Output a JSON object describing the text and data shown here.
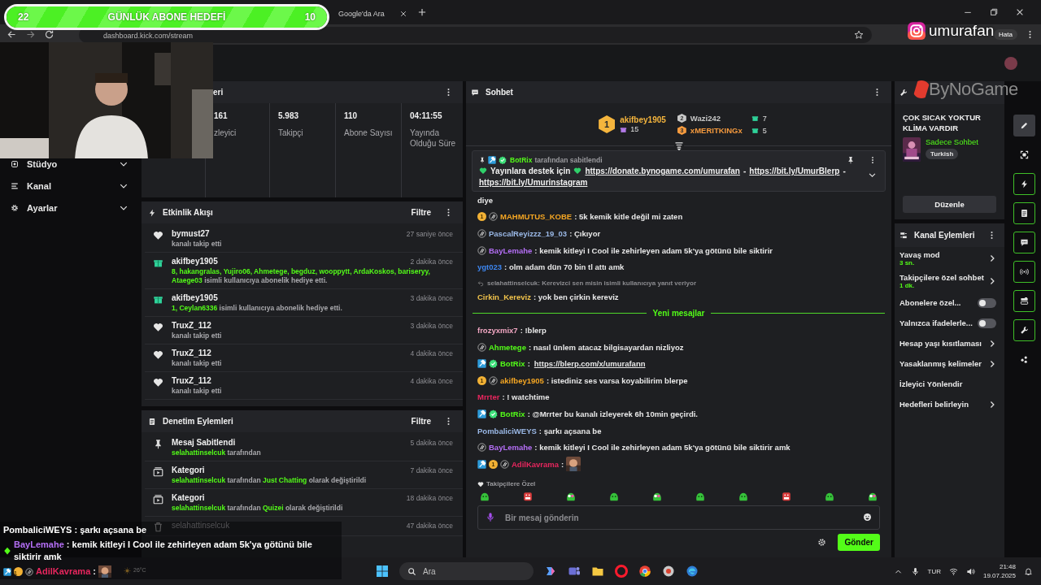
{
  "browser": {
    "tabs": [
      {
        "title": "Google'da Ara",
        "selected": false
      }
    ],
    "url": "dashboard.kick.com/stream",
    "profile": "Hata"
  },
  "sidebar": [
    {
      "kind": "studio",
      "label": "Stüdyo"
    },
    {
      "kind": "channel",
      "label": "Kanal"
    },
    {
      "kind": "settings",
      "label": "Ayarlar"
    }
  ],
  "stats": {
    "title": "eri",
    "items": [
      {
        "value": "161",
        "label": "zleyici"
      },
      {
        "value": "5.983",
        "label": "Takipçi"
      },
      {
        "value": "110",
        "label": "Abone Sayısı"
      },
      {
        "value": "04:11:55",
        "label": "Yayında Olduğu Süre"
      }
    ]
  },
  "events": {
    "title": "Etkinlik Akışı",
    "filter": "Filtre",
    "items": [
      {
        "kind": "follow",
        "user": "bymust27",
        "time": "27 saniye önce",
        "text": "kanalı takip etti"
      },
      {
        "kind": "gift",
        "user": "akifbey1905",
        "time": "2 dakika önce",
        "names": "8, hakangralas, Yujiro06, Ahmetege, begduz, wooppytt, ArdaKoskos, bariseryy, Ataege03",
        "text": "isimli kullanıcıya abonelik hediye etti."
      },
      {
        "kind": "gift",
        "user": "akifbey1905",
        "time": "3 dakika önce",
        "names": "1, Ceylan6336",
        "text": "isimli kullanıcıya abonelik hediye etti."
      },
      {
        "kind": "follow",
        "user": "TruxZ_112",
        "time": "3 dakika önce",
        "text": "kanalı takip etti"
      },
      {
        "kind": "follow",
        "user": "TruxZ_112",
        "time": "4 dakika önce",
        "text": "kanalı takip etti"
      },
      {
        "kind": "follow",
        "user": "TruxZ_112",
        "time": "4 dakika önce",
        "text": "kanalı takip etti"
      }
    ]
  },
  "moderation": {
    "title": "Denetim Eylemleri",
    "filter": "Filtre",
    "items": [
      {
        "kind": "pin",
        "title": "Mesaj Sabitlendi",
        "time": "5 dakika önce",
        "detail": [
          {
            "text": "selahattinselcuk",
            "highlight": true
          },
          {
            "text": "tarafından",
            "highlight": false
          }
        ]
      },
      {
        "kind": "category",
        "title": "Kategori",
        "time": "7 dakika önce",
        "detail": [
          {
            "text": "selahattinselcuk",
            "highlight": true
          },
          {
            "text": "tarafından",
            "highlight": false
          },
          {
            "text": "Just Chatting",
            "highlight": true
          },
          {
            "text": "olarak değiştirildi",
            "highlight": false
          }
        ]
      },
      {
        "kind": "category",
        "title": "Kategori",
        "time": "18 dakika önce",
        "detail": [
          {
            "text": "selahattinselcuk",
            "highlight": true
          },
          {
            "text": "tarafından",
            "highlight": false
          },
          {
            "text": "Quizei",
            "highlight": true
          },
          {
            "text": "olarak değiştirildi",
            "highlight": false
          }
        ]
      },
      {
        "kind": "delete",
        "title": "selahattinselcuk",
        "time": "47 dakika önce"
      }
    ]
  },
  "chat": {
    "title": "Sohbet",
    "leaderboard": [
      {
        "rank": "1",
        "user": "akifbey1905",
        "count": "15",
        "color": "#f5b53d"
      },
      {
        "rank": "2",
        "user": "Wazi242",
        "count": "7",
        "color": "#c8c8c8"
      },
      {
        "rank": "3",
        "user": "xMERITKINGx",
        "count": "5",
        "color": "#f59a3e"
      }
    ],
    "pinned": {
      "by": "BotRix",
      "note": "tarafından sabitlendi",
      "parts": [
        {
          "kind": "emoji"
        },
        {
          "kind": "text",
          "text": "Yayınlara destek için"
        },
        {
          "kind": "emoji"
        },
        {
          "kind": "link",
          "text": "https://donate.bynogame.com/umurafan"
        },
        {
          "kind": "text",
          "text": "-"
        },
        {
          "kind": "link",
          "text": "https://bit.ly/UmurBlerp"
        },
        {
          "kind": "text",
          "text": "-"
        },
        {
          "kind": "link",
          "text": "https://bit.ly/Umurinstagram"
        }
      ]
    },
    "messages": [
      {
        "kind": "continuation",
        "text": "diye"
      },
      {
        "kind": "message",
        "badges": [
          {
            "kind": "gifter",
            "text": "1"
          },
          {
            "kind": "og"
          }
        ],
        "user": "MAHMUTUS_KOBE",
        "color": "#f5a623",
        "text": ": 5k kemik kitle değil mi zaten"
      },
      {
        "kind": "message",
        "badges": [
          {
            "kind": "og"
          }
        ],
        "user": "PascalReyizzz_19_03",
        "color": "#9ab8e6",
        "text": ": Çıkıyor"
      },
      {
        "kind": "message",
        "badges": [
          {
            "kind": "og"
          }
        ],
        "user": "BayLemahe",
        "color": "#b46ef5",
        "text": ": kemik kitleyi I Cool ile zehirleyen adam 5k'ya götünü bile siktirir"
      },
      {
        "kind": "message",
        "user": "ygt023",
        "color": "#3d86f0",
        "text": ": olm adam dün 70 bin tl attı amk"
      },
      {
        "kind": "reply",
        "text": "selahattinselcuk: Kerevizci sen misin isimli kullanıcıya yanıt veriyor"
      },
      {
        "kind": "message",
        "user": "Cirkin_Kereviz",
        "color": "#f0c24b",
        "text": ": yok ben çirkin kereviz"
      },
      {
        "kind": "divider",
        "text": "Yeni mesajlar"
      },
      {
        "kind": "message",
        "user": "frozyxmix7",
        "color": "#f2a7c3",
        "text": ": !blerp"
      },
      {
        "kind": "message",
        "badges": [
          {
            "kind": "og"
          }
        ],
        "user": "Ahmetege",
        "color": "#53fc18",
        "text": ": nasıl ünlem atacaz bilgisayardan nizliyoz"
      },
      {
        "kind": "message",
        "badges": [
          {
            "kind": "mod"
          },
          {
            "kind": "verified"
          }
        ],
        "user": "BotRix",
        "color": "#53fc18",
        "text": ":",
        "link": "https://blerp.com/x/umurafann"
      },
      {
        "kind": "message",
        "badges": [
          {
            "kind": "gifter",
            "text": "1"
          },
          {
            "kind": "og"
          }
        ],
        "user": "akifbey1905",
        "color": "#f5a623",
        "text": ": istediniz ses varsa koyabilirim blerpe"
      },
      {
        "kind": "message",
        "user": "Mrrter",
        "color": "#e8265e",
        "text": ": ! watchtime"
      },
      {
        "kind": "message",
        "badges": [
          {
            "kind": "mod"
          },
          {
            "kind": "verified"
          }
        ],
        "user": "BotRix",
        "color": "#53fc18",
        "text": ": @Mrrter bu kanalı izleyerek 6h 10min geçirdi."
      },
      {
        "kind": "message",
        "user": "PombaliciWEYS",
        "color": "#9ab8e6",
        "text": ": şarkı açsana be"
      },
      {
        "kind": "message",
        "badges": [
          {
            "kind": "og"
          }
        ],
        "user": "BayLemahe",
        "color": "#b46ef5",
        "text": ": kemik kitleyi I Cool ile zehirleyen adam 5k'ya götünü bile siktirir amk"
      },
      {
        "kind": "message",
        "badges": [
          {
            "kind": "mod"
          },
          {
            "kind": "gifter",
            "text": "1"
          },
          {
            "kind": "og"
          }
        ],
        "user": "AdilKavrama",
        "color": "#e8265e",
        "text": ":",
        "emote": true
      }
    ],
    "emote_label": "Takipçilere Özel",
    "emotes": [
      {
        "kind": "green"
      },
      {
        "kind": "red"
      },
      {
        "kind": "mixed"
      },
      {
        "kind": "green"
      },
      {
        "kind": "mixed"
      },
      {
        "kind": "green"
      },
      {
        "kind": "green"
      },
      {
        "kind": "red"
      },
      {
        "kind": "green"
      },
      {
        "kind": "mixed"
      }
    ],
    "input": {
      "placeholder": "Bir mesaj gönderin"
    },
    "send": "Gönder"
  },
  "stream_info": {
    "title": "ÇOK SICAK YOKTUR KLİMA VARDIR",
    "category": "Sadece Sohbet",
    "tags": [
      "Turkish"
    ],
    "edit": "Düzenle"
  },
  "channel_actions": {
    "title": "Kanal Eylemleri",
    "items": [
      {
        "kind": "link",
        "label": "Yavaş mod",
        "value": "3 sn."
      },
      {
        "kind": "link",
        "label": "Takipçilere özel sohbet",
        "value": "1 dk."
      },
      {
        "kind": "toggle",
        "label": "Abonelere özel...",
        "on": false
      },
      {
        "kind": "toggle",
        "label": "Yalnızca ifadelerle...",
        "on": false
      },
      {
        "kind": "link",
        "label": "Hesap yaşı kısıtlaması"
      },
      {
        "kind": "link",
        "label": "Yasaklanmış kelimeler"
      },
      {
        "kind": "plain",
        "label": "İzleyici Yönlendir"
      },
      {
        "kind": "link",
        "label": "Hedefleri belirleyin"
      }
    ]
  },
  "rail": [
    {
      "kind": "edit",
      "selected": true,
      "open": false
    },
    {
      "kind": "focus",
      "selected": false,
      "open": false
    },
    {
      "kind": "events",
      "selected": false,
      "open": true
    },
    {
      "kind": "log",
      "selected": false,
      "open": true
    },
    {
      "kind": "chat",
      "selected": false,
      "open": true
    },
    {
      "kind": "broadcast",
      "selected": false,
      "open": true
    },
    {
      "kind": "media",
      "selected": false,
      "open": true
    },
    {
      "kind": "tools",
      "selected": false,
      "open": true
    },
    {
      "kind": "more",
      "selected": false,
      "open": false
    }
  ],
  "taskbar": {
    "weather": "26°C",
    "search": "Ara",
    "apps": [
      {
        "kind": "copilot"
      },
      {
        "kind": "teams"
      },
      {
        "kind": "files"
      },
      {
        "kind": "opera"
      },
      {
        "kind": "chrome"
      },
      {
        "kind": "app"
      },
      {
        "kind": "edge"
      }
    ],
    "language": "TUR",
    "time": "21:48",
    "date": "19.07.2025"
  },
  "stream_overlay": {
    "goal": {
      "start": "22",
      "title": "GÜNLÜK ABONE HEDEFİ",
      "end": "10",
      "level": 1
    },
    "instagram": "umurafan",
    "logo": "ByNoGame",
    "chat": [
      {
        "user": "PombaliciWEYS",
        "color": "#ffffff",
        "text": ": şarkı açsana be"
      },
      {
        "badges": [
          {
            "kind": "diamond"
          }
        ],
        "user": "BayLemahe",
        "color": "#b46ef5",
        "text": ": kemik kitleyi I Cool ile zehirleyen adam 5k'ya götünü bile siktirir amk"
      },
      {
        "badges": [
          {
            "kind": "mod"
          },
          {
            "kind": "gifter",
            "text": "1"
          },
          {
            "kind": "og"
          }
        ],
        "user": "AdilKavrama",
        "color": "#e8265e",
        "text": ":",
        "emote": true
      }
    ]
  }
}
